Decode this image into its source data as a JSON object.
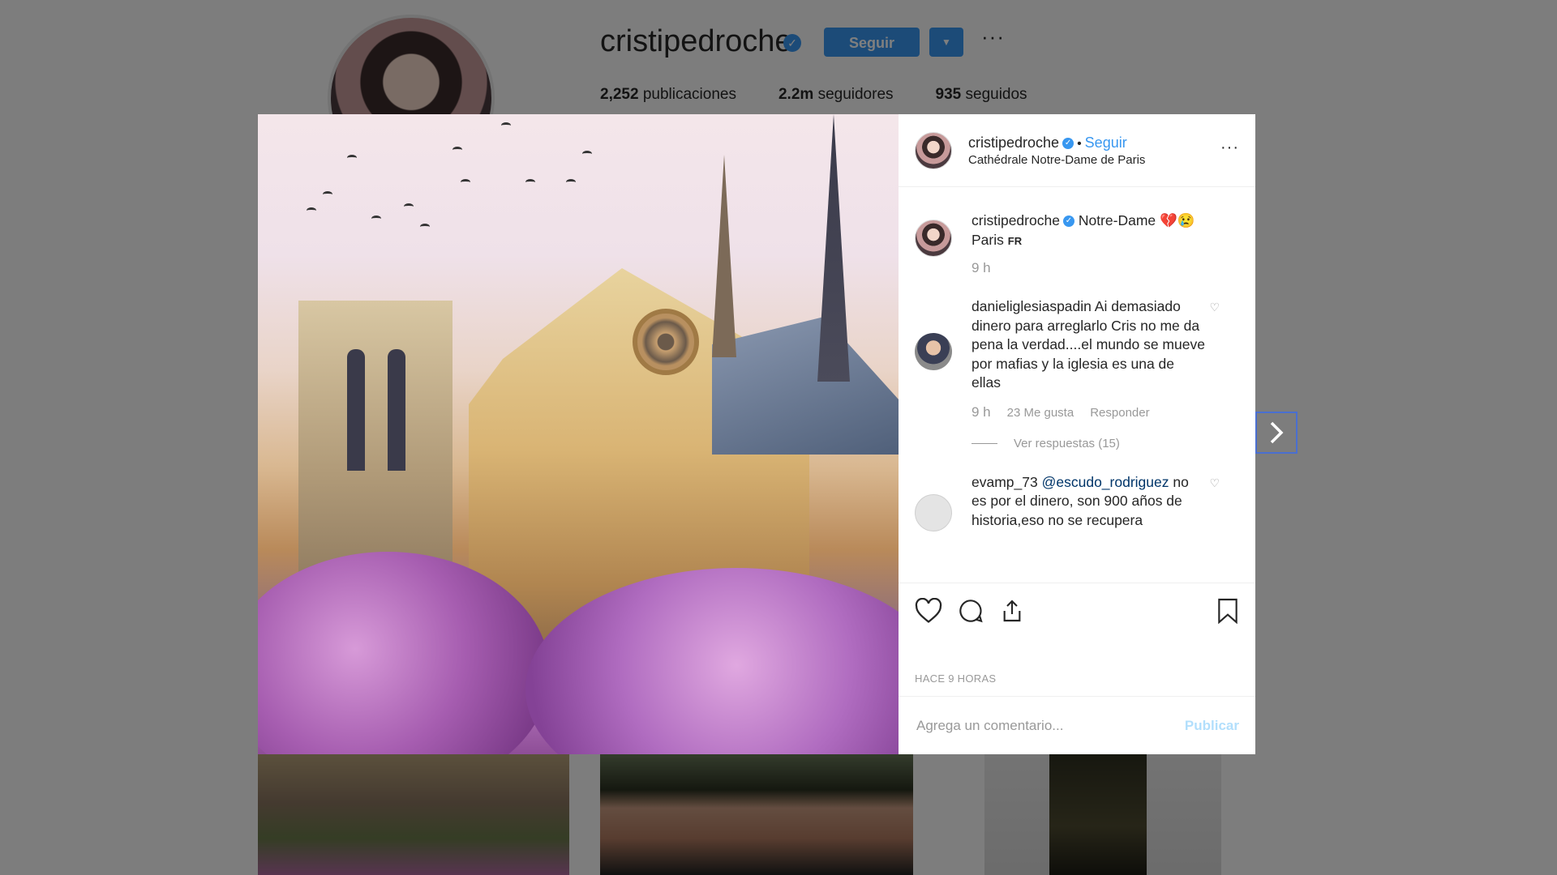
{
  "profile": {
    "username": "cristipedroche",
    "follow_label": "Seguir",
    "stats": [
      {
        "value": "2,252",
        "label": "publicaciones"
      },
      {
        "value": "2.2m",
        "label": "seguidores"
      },
      {
        "value": "935",
        "label": "seguidos"
      }
    ]
  },
  "post": {
    "author": "cristipedroche",
    "follow_label": "Seguir",
    "separator": "•",
    "location": "Cathédrale Notre-Dame de Paris",
    "caption_text": "Notre-Dame",
    "caption_emojis": "💔😢",
    "caption_line2": "Paris",
    "caption_flag": "FR",
    "caption_time": "9 h",
    "timestamp": "HACE 9 HORAS"
  },
  "comments": [
    {
      "user": "danieliglesiaspadin",
      "text": "Ai demasiado dinero para arreglarlo Cris no me da pena la verdad....el mundo se mueve por mafias y la iglesia es una de ellas",
      "time": "9 h",
      "likes": "23 Me gusta",
      "reply_label": "Responder",
      "view_replies": "Ver respuestas (15)"
    },
    {
      "user": "evamp_73",
      "mention": "@escudo_rodriguez",
      "text": "no es por el dinero, son 900 años de historia,eso no se recupera"
    }
  ],
  "comment_box": {
    "placeholder": "Agrega un comentario...",
    "publish_label": "Publicar"
  },
  "icons": {
    "like": "heart-icon",
    "comment": "comment-icon",
    "share": "share-icon",
    "save": "bookmark-icon",
    "next": "chevron-right-icon",
    "verified": "verified-badge-icon",
    "more": "more-options-icon"
  },
  "colors": {
    "accent": "#3897f0",
    "muted": "#999999",
    "overlay": "rgba(0,0,0,0.5)"
  }
}
